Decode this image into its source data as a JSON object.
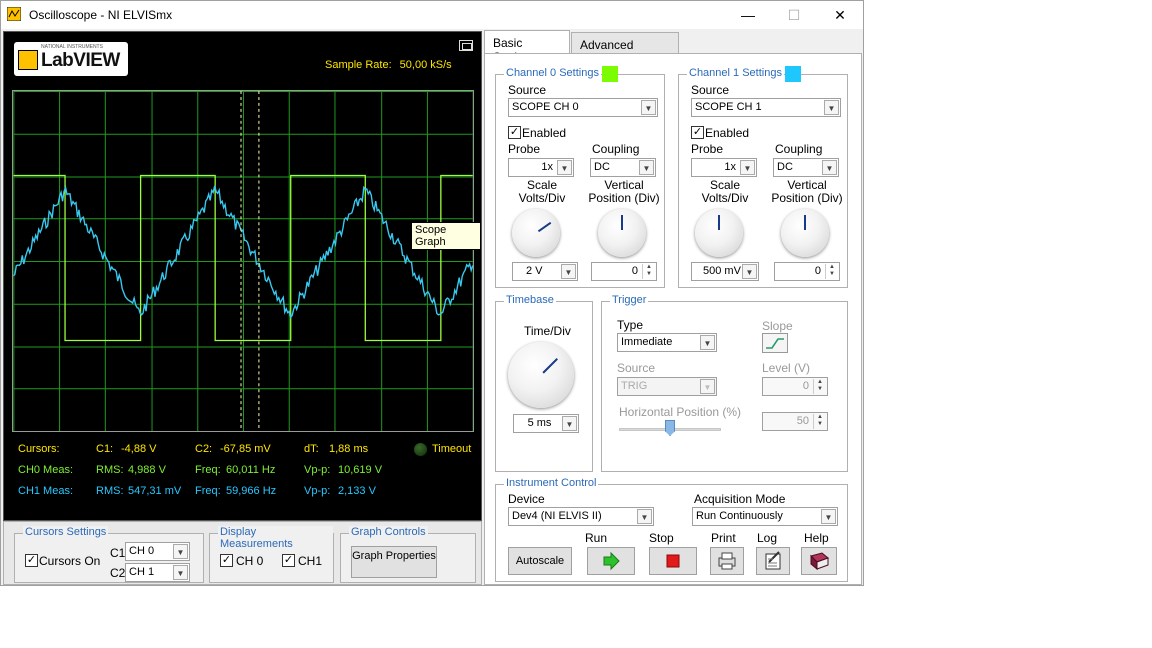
{
  "window": {
    "title": "Oscilloscope - NI ELVISmx",
    "minimize": "—",
    "maximize": "☐",
    "close": "✕"
  },
  "labview": {
    "small": "NATIONAL INSTRUMENTS",
    "brand": "LabVIEW"
  },
  "sample_rate": {
    "label": "Sample Rate:",
    "value": "50,00 kS/s"
  },
  "tooltip": "Scope Graph",
  "measurements": {
    "cursors": {
      "label": "Cursors:",
      "c1": "C1:",
      "c1_val": "-4,88 V",
      "c2": "C2:",
      "c2_val": "-67,85 mV",
      "dt": "dT:",
      "dt_val": "1,88 ms"
    },
    "ch0": {
      "label": "CH0 Meas:",
      "rms": "RMS:",
      "rms_val": "4,988 V",
      "freq": "Freq:",
      "freq_val": "60,011 Hz",
      "vpp": "Vp-p:",
      "vpp_val": "10,619 V"
    },
    "ch1": {
      "label": "CH1 Meas:",
      "rms": "RMS:",
      "rms_val": "547,31 mV",
      "freq": "Freq:",
      "freq_val": "59,966 Hz",
      "vpp": "Vp-p:",
      "vpp_val": "2,133 V"
    },
    "timeout": "Timeout"
  },
  "cursors_settings": {
    "title": "Cursors Settings",
    "cursors_on": "Cursors On",
    "c1": "C1",
    "c1_val": "CH 0",
    "c2": "C2",
    "c2_val": "CH 1"
  },
  "display_measurements": {
    "title": "Display Measurements",
    "ch0": "CH 0",
    "ch1": "CH1"
  },
  "graph_controls": {
    "title": "Graph Controls",
    "button": "Graph Properties"
  },
  "tabs": [
    {
      "label": "Basic Settings"
    },
    {
      "label": "Advanced Settings"
    }
  ],
  "channel0": {
    "title": "Channel 0 Settings",
    "color": "#7cfc00",
    "source_label": "Source",
    "source": "SCOPE CH 0",
    "enabled": "Enabled",
    "probe_label": "Probe",
    "probe": "1x",
    "coupling_label": "Coupling",
    "coupling": "DC",
    "scale_label": "Scale Volts/Div",
    "position_label": "Vertical Position (Div)",
    "scale": "2 V",
    "position": "0"
  },
  "channel1": {
    "title": "Channel 1 Settings",
    "color": "#1ec8ff",
    "source_label": "Source",
    "source": "SCOPE CH 1",
    "enabled": "Enabled",
    "probe_label": "Probe",
    "probe": "1x",
    "coupling_label": "Coupling",
    "coupling": "DC",
    "scale_label": "Scale Volts/Div",
    "position_label": "Vertical Position (Div)",
    "scale": "500 mV",
    "position": "0"
  },
  "timebase": {
    "title": "Timebase",
    "label": "Time/Div",
    "value": "5 ms"
  },
  "trigger": {
    "title": "Trigger",
    "type_label": "Type",
    "type": "Immediate",
    "slope_label": "Slope",
    "source_label": "Source",
    "source": "TRIG",
    "level_label": "Level (V)",
    "level": "0",
    "hpos_label": "Horizontal Position (%)",
    "hpos": "50"
  },
  "instrument": {
    "title": "Instrument Control",
    "device_label": "Device",
    "device": "Dev4 (NI ELVIS II)",
    "acq_label": "Acquisition Mode",
    "acq": "Run Continuously",
    "autoscale": "Autoscale",
    "run": "Run",
    "stop": "Stop",
    "print": "Print",
    "log": "Log",
    "help": "Help"
  }
}
